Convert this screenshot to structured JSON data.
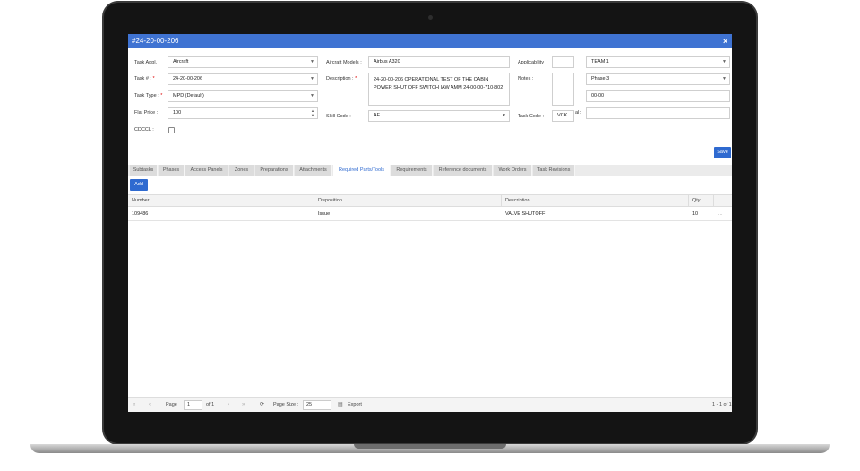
{
  "window": {
    "title": "#24-20-00-206",
    "close": "×"
  },
  "form": {
    "task_appl_label": "Task Appl. :",
    "task_appl_value": "Aircraft",
    "task_no_label": "Task # :",
    "task_no_value": "24-20-00-206",
    "task_type_label": "Task Type :",
    "task_type_value": "MPD (Default)",
    "flat_price_label": "Flat Price :",
    "flat_price_value": "100",
    "cdccl_label": "CDCCL :",
    "aircraft_models_label": "Aircraft Models :",
    "aircraft_models_value": "Airbus A320",
    "description_label": "Description :",
    "description_value": "24-20-00-206 OPERATIONAL TEST OF THE CABIN POWER SHUT OFF SWITCH IAW AMM 24-00-00-710-802",
    "skill_code_label": "Skill Code :",
    "skill_code_value": "AF",
    "applicability_label": "Applicability :",
    "notes_label": "Notes :",
    "task_code_label": "Task Code :",
    "task_code_value": "VCK",
    "extra_label": "al :",
    "team_value": "TEAM 1",
    "phase_value": "Phase 3",
    "zone_value": "00-00",
    "required_mark": "*"
  },
  "buttons": {
    "save": "Save",
    "add": "Add"
  },
  "tabs": [
    {
      "label": "Subtasks",
      "active": false
    },
    {
      "label": "Phases",
      "active": false
    },
    {
      "label": "Access Panels",
      "active": false
    },
    {
      "label": "Zones",
      "active": false
    },
    {
      "label": "Preparations",
      "active": false
    },
    {
      "label": "Attachments",
      "active": false
    },
    {
      "label": "Required Parts/Tools",
      "active": true
    },
    {
      "label": "Requirements",
      "active": false
    },
    {
      "label": "Reference documents",
      "active": false
    },
    {
      "label": "Work Orders",
      "active": false
    },
    {
      "label": "Task Revisions",
      "active": false
    }
  ],
  "grid": {
    "columns": [
      "Number",
      "Disposition",
      "Description",
      "Qty"
    ],
    "rows": [
      {
        "number": "109486",
        "disposition": "Issue",
        "description": "VALVE SHUTOFF",
        "qty": "10",
        "menu": "..."
      }
    ]
  },
  "pager": {
    "page_label": "Page",
    "page_value": "1",
    "of_label": "of 1",
    "page_size_label": "Page Size :",
    "page_size_value": "25",
    "export_label": "Export",
    "range": "1 - 1 of 1"
  },
  "colors": {
    "accent": "#3f73d2",
    "button": "#2f6ad0"
  }
}
